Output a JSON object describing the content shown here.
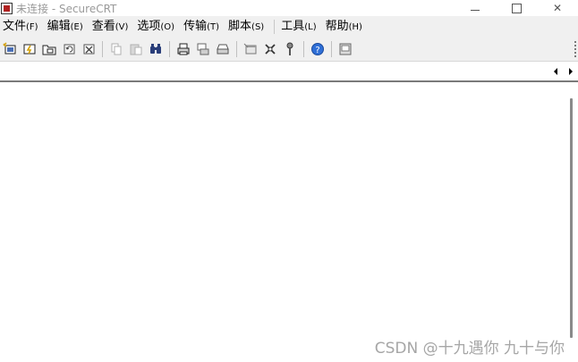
{
  "window": {
    "title": "未连接 - SecureCRT",
    "close_glyph": "✕"
  },
  "menu": [
    {
      "label": "文件",
      "accel": "(F)"
    },
    {
      "label": "编辑",
      "accel": "(E)"
    },
    {
      "label": "查看",
      "accel": "(V)"
    },
    {
      "label": "选项",
      "accel": "(O)"
    },
    {
      "label": "传输",
      "accel": "(T)"
    },
    {
      "label": "脚本",
      "accel": "(S)"
    },
    {
      "label": "工具",
      "accel": "(L)"
    },
    {
      "label": "帮助",
      "accel": "(H)"
    }
  ],
  "toolbar": {
    "icons": [
      "connect-icon",
      "quick-connect-icon",
      "connect-tab-icon",
      "reconnect-icon",
      "disconnect-icon",
      "copy-icon",
      "paste-icon",
      "find-icon",
      "print-icon",
      "print-setup-icon",
      "print-selection-icon",
      "session-options-icon",
      "keymap-icon",
      "key-icon",
      "help-icon",
      "screen-icon"
    ]
  },
  "colors": {
    "menu_bg": "#f0f0f0",
    "toolbar_bg": "#f0f0f0",
    "session_bg": "#ffffff",
    "watermark": "#a6a6a6",
    "title_text": "#9a9a9a"
  },
  "watermark": "CSDN @十九遇你 九十与你"
}
